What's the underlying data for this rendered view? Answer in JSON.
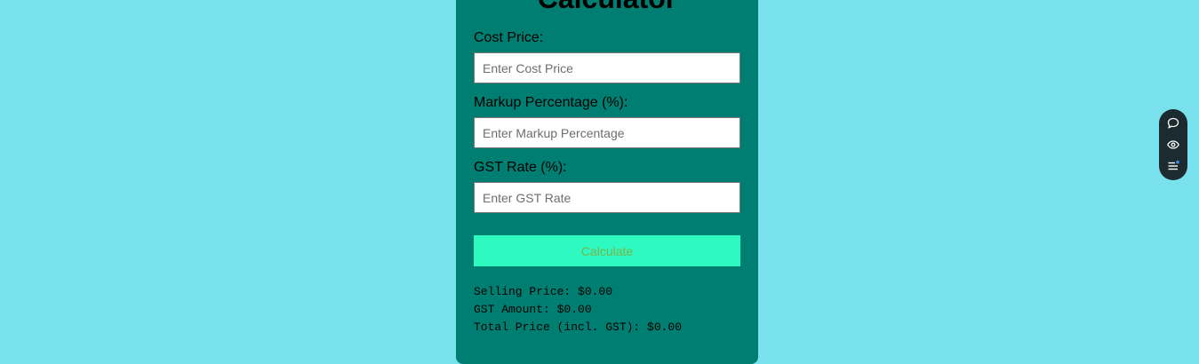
{
  "calculator": {
    "title": "Calculator",
    "fields": [
      {
        "label": "Cost Price:",
        "placeholder": "Enter Cost Price",
        "value": ""
      },
      {
        "label": "Markup Percentage (%):",
        "placeholder": "Enter Markup Percentage",
        "value": ""
      },
      {
        "label": "GST Rate (%):",
        "placeholder": "Enter GST Rate",
        "value": ""
      }
    ],
    "button_label": "Calculate",
    "results": [
      "Selling Price: $0.00",
      "GST Amount: $0.00",
      "Total Price (incl. GST): $0.00"
    ]
  },
  "toolbar": {
    "icons": [
      "chat-icon",
      "eye-icon",
      "list-icon"
    ]
  },
  "colors": {
    "background": "#79e1ec",
    "card": "#007e71",
    "button": "#2ef9c0",
    "button_text": "#7ab44a",
    "toolbar": "#1c2b2f"
  }
}
